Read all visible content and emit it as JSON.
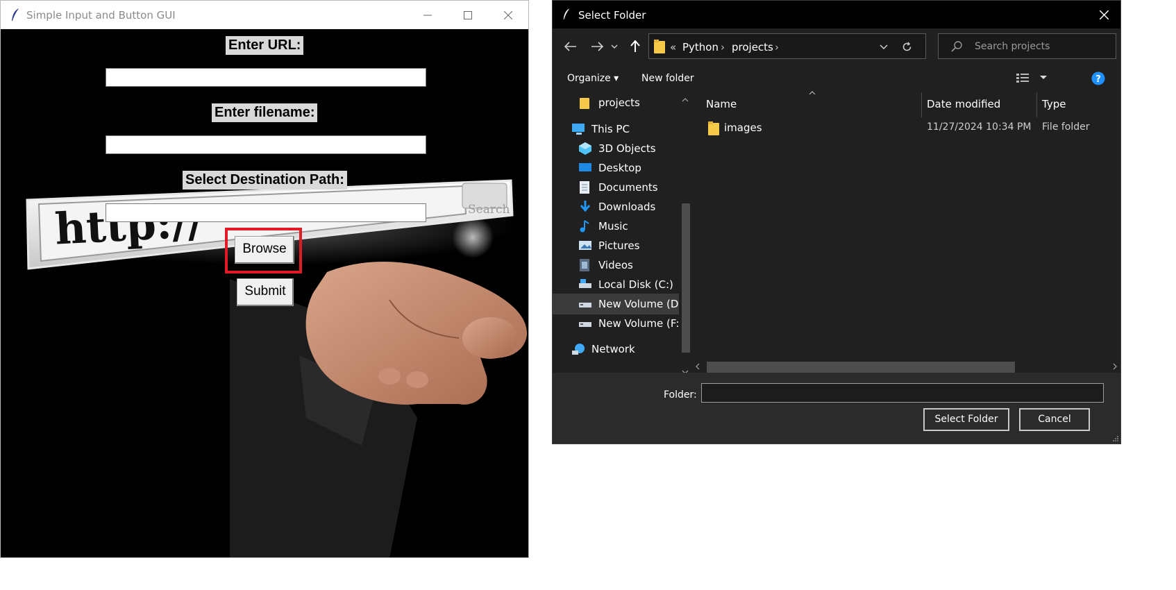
{
  "tk_window": {
    "title": "Simple Input and Button GUI",
    "url_label": "Enter URL:",
    "url_value": "",
    "filename_label": "Enter filename:",
    "filename_value": "",
    "dest_label": "Select Destination Path:",
    "dest_value": "",
    "browse_label": "Browse",
    "submit_label": "Submit",
    "bg_text_http": "http://",
    "bg_text_search": "Search"
  },
  "dialog": {
    "title": "Select Folder",
    "breadcrumb": [
      "«",
      "Python",
      "projects"
    ],
    "search_placeholder": "Search projects",
    "toolbar": {
      "organize": "Organize ▾",
      "new_folder": "New folder"
    },
    "nav_items": [
      {
        "label": "projects",
        "icon": "folder-icon"
      },
      {
        "label": "This PC",
        "icon": "pc-icon"
      },
      {
        "label": "3D Objects",
        "icon": "cube-icon"
      },
      {
        "label": "Desktop",
        "icon": "desktop-icon"
      },
      {
        "label": "Documents",
        "icon": "document-icon"
      },
      {
        "label": "Downloads",
        "icon": "download-icon"
      },
      {
        "label": "Music",
        "icon": "music-icon"
      },
      {
        "label": "Pictures",
        "icon": "picture-icon"
      },
      {
        "label": "Videos",
        "icon": "video-icon"
      },
      {
        "label": "Local Disk (C:)",
        "icon": "drive-icon"
      },
      {
        "label": "New Volume (D:",
        "icon": "drive-icon"
      },
      {
        "label": "New Volume (F:)",
        "icon": "drive-icon"
      },
      {
        "label": "Network",
        "icon": "network-icon"
      }
    ],
    "columns": {
      "name": "Name",
      "date": "Date modified",
      "type": "Type"
    },
    "files": [
      {
        "name": "images",
        "date": "11/27/2024 10:34 PM",
        "type": "File folder"
      }
    ],
    "folder_label": "Folder:",
    "folder_value": "",
    "select_button": "Select Folder",
    "cancel_button": "Cancel"
  },
  "colors": {
    "highlight": "#e01b24",
    "folder_yellow": "#f7c948",
    "accent_blue": "#1e90ff"
  }
}
